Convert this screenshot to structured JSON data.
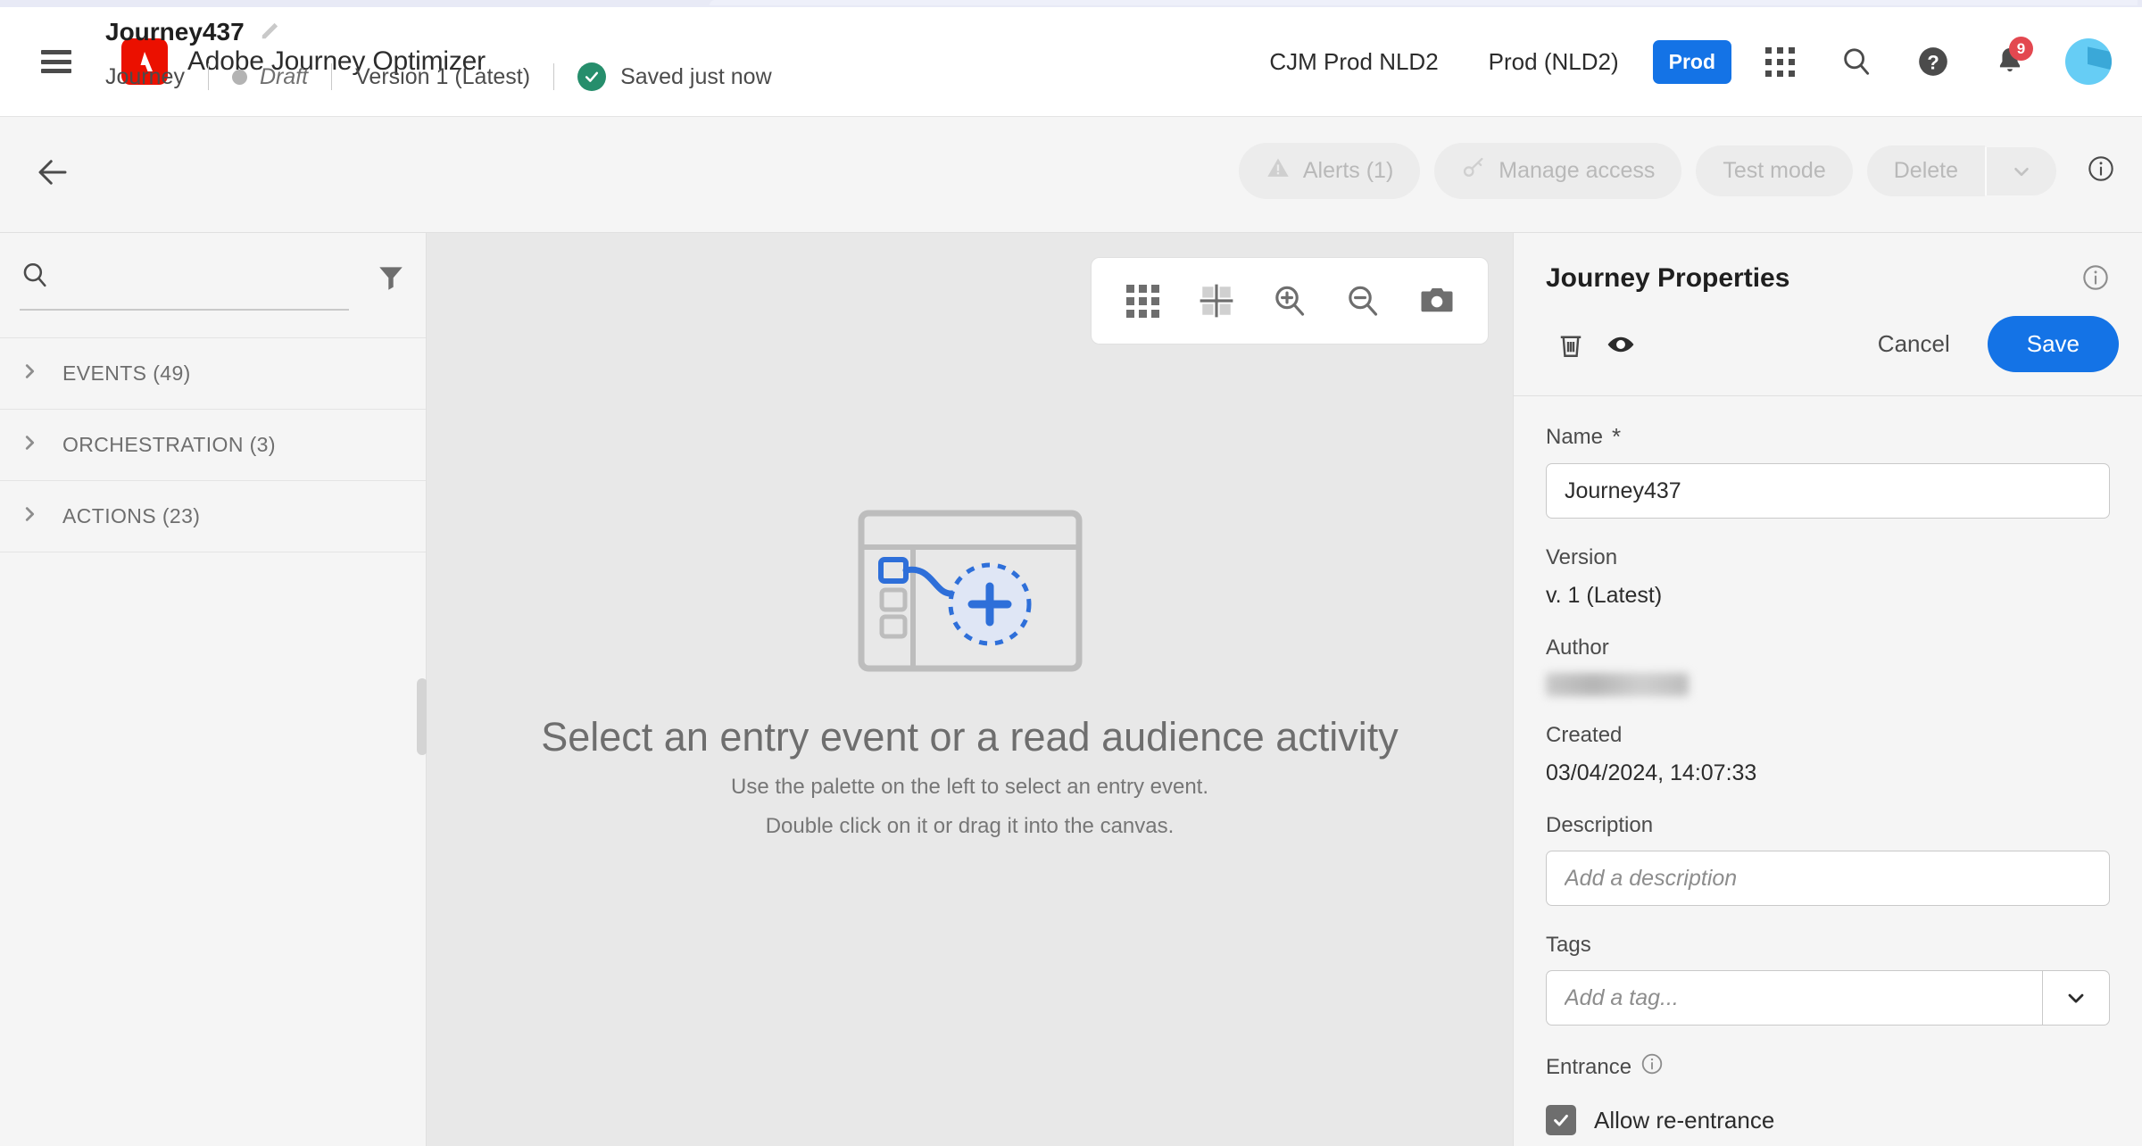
{
  "app": {
    "brand_title": "Adobe Journey Optimizer",
    "logo_icon": "adobe-logo-icon",
    "menu_icon": "hamburger-menu-icon"
  },
  "header": {
    "org_name": "CJM Prod NLD2",
    "sandbox_name": "Prod (NLD2)",
    "env_pill": "Prod",
    "apps_icon": "apps-grid-icon",
    "search_icon": "search-icon",
    "help_icon": "help-circle-icon",
    "bell_icon": "bell-icon",
    "notification_count": "9",
    "avatar_icon": "user-avatar"
  },
  "subheader": {
    "back_icon": "back-arrow-icon",
    "journey_name": "Journey437",
    "edit_icon": "pencil-edit-icon",
    "type_label": "Journey",
    "status_label": "Draft",
    "version_label": "Version 1 (Latest)",
    "saved_label": "Saved just now",
    "saved_icon": "checkmark-circle-icon",
    "actions": {
      "alerts_label": "Alerts (1)",
      "alerts_icon": "alert-triangle-icon",
      "manage_access_label": "Manage access",
      "manage_access_icon": "key-icon",
      "test_mode_label": "Test mode",
      "delete_label": "Delete",
      "more_icon": "chevron-down-icon",
      "info_icon": "info-circle-icon"
    }
  },
  "palette": {
    "search_placeholder": "",
    "search_value": "",
    "search_icon": "search-icon",
    "filter_icon": "filter-funnel-icon",
    "sections": [
      {
        "label": "EVENTS (49)",
        "icon": "chevron-right-icon"
      },
      {
        "label": "ORCHESTRATION (3)",
        "icon": "chevron-right-icon"
      },
      {
        "label": "ACTIONS (23)",
        "icon": "chevron-right-icon"
      }
    ]
  },
  "canvas": {
    "toolbar": [
      {
        "name": "grid-view-icon"
      },
      {
        "name": "fit-to-screen-icon"
      },
      {
        "name": "zoom-in-icon"
      },
      {
        "name": "zoom-out-icon"
      },
      {
        "name": "screenshot-camera-icon"
      }
    ],
    "empty_state": {
      "illustration": "canvas-add-entry-illustration",
      "title": "Select an entry event or a read audience activity",
      "line1": "Use the palette on the left to select an entry event.",
      "line2": "Double click on it or drag it into the canvas."
    }
  },
  "properties": {
    "title": "Journey Properties",
    "info_icon": "info-circle-icon",
    "delete_icon": "trash-icon",
    "preview_icon": "eye-preview-icon",
    "cancel_label": "Cancel",
    "save_label": "Save",
    "fields": {
      "name_label": "Name",
      "name_required": "*",
      "name_value": "Journey437",
      "name_placeholder": "",
      "version_label": "Version",
      "version_value": "v. 1 (Latest)",
      "author_label": "Author",
      "author_value": "",
      "created_label": "Created",
      "created_value": "03/04/2024, 14:07:33",
      "description_label": "Description",
      "description_value": "",
      "description_placeholder": "Add a description",
      "tags_label": "Tags",
      "tags_value": "",
      "tags_placeholder": "Add a tag...",
      "tags_caret_icon": "chevron-down-icon",
      "entrance_label": "Entrance",
      "entrance_info_icon": "info-circle-icon",
      "reentrance_label": "Allow re-entrance",
      "reentrance_checked": true
    }
  },
  "colors": {
    "adobe_red": "#eb1000",
    "accent_blue": "#1473e6",
    "badge_red": "#e34850",
    "success_green": "#268e6c",
    "canvas_bg": "#e8e8e8",
    "panel_bg": "#f5f5f5"
  }
}
